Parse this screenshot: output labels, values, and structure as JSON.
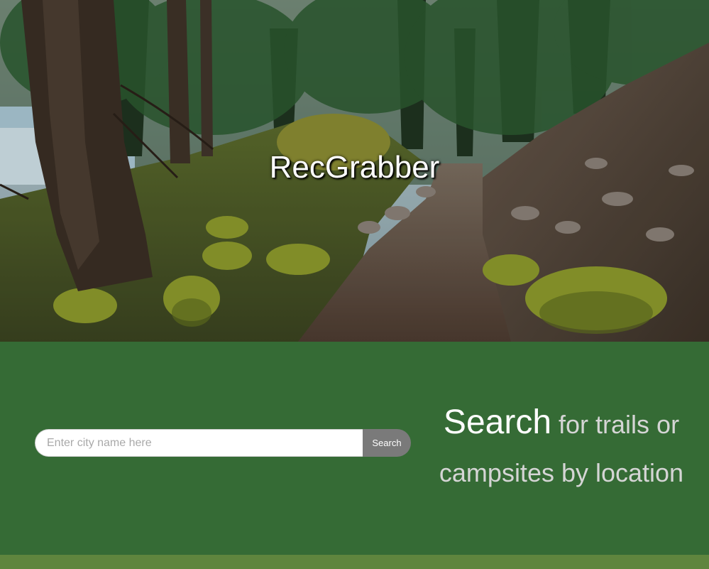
{
  "brand": {
    "title": "RecGrabber"
  },
  "hero": {
    "image_icon": "forest-trail-photo"
  },
  "search": {
    "placeholder": "Enter city name here",
    "value": "",
    "button_label": "Search"
  },
  "tagline": {
    "emphasis": "Search",
    "line1_rest": " for trails or",
    "line2": "campsites by location"
  },
  "colors": {
    "section_bg": "#356b35",
    "footer_bg": "#5f853e",
    "button_bg": "#7a7a7a",
    "tagline_text": "#d5d5d5"
  }
}
